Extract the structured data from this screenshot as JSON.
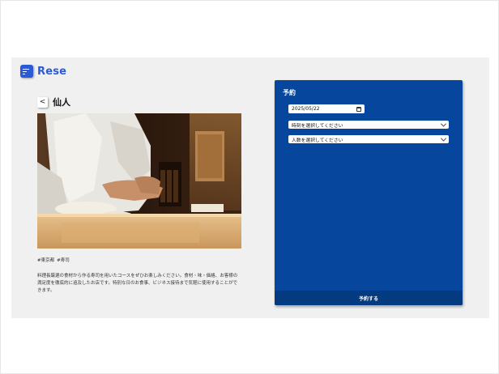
{
  "app": {
    "brand": "Rese"
  },
  "shop": {
    "back_label": "<",
    "name": "仙人",
    "tags": [
      "#東京都",
      "#寿司"
    ],
    "description": "料理長厳選の食材から作る寿司を用いたコースをぜひお楽しみください。食材・味・価格、お客様の満足度を徹底的に追及したお店です。特別な日のお食事、ビジネス接待まで気軽に使用することができます。"
  },
  "reservation": {
    "title": "予約",
    "date_value": "2025/05/22",
    "time_placeholder": "時刻を選択してください",
    "people_placeholder": "人数を選択してください",
    "submit_label": "予約する"
  },
  "colors": {
    "brand": "#2a5ad6",
    "panel": "#06469c",
    "panel_footer": "#033a80"
  },
  "icons": [
    "menu-logo-icon",
    "calendar-icon",
    "chevron-down-icon"
  ]
}
